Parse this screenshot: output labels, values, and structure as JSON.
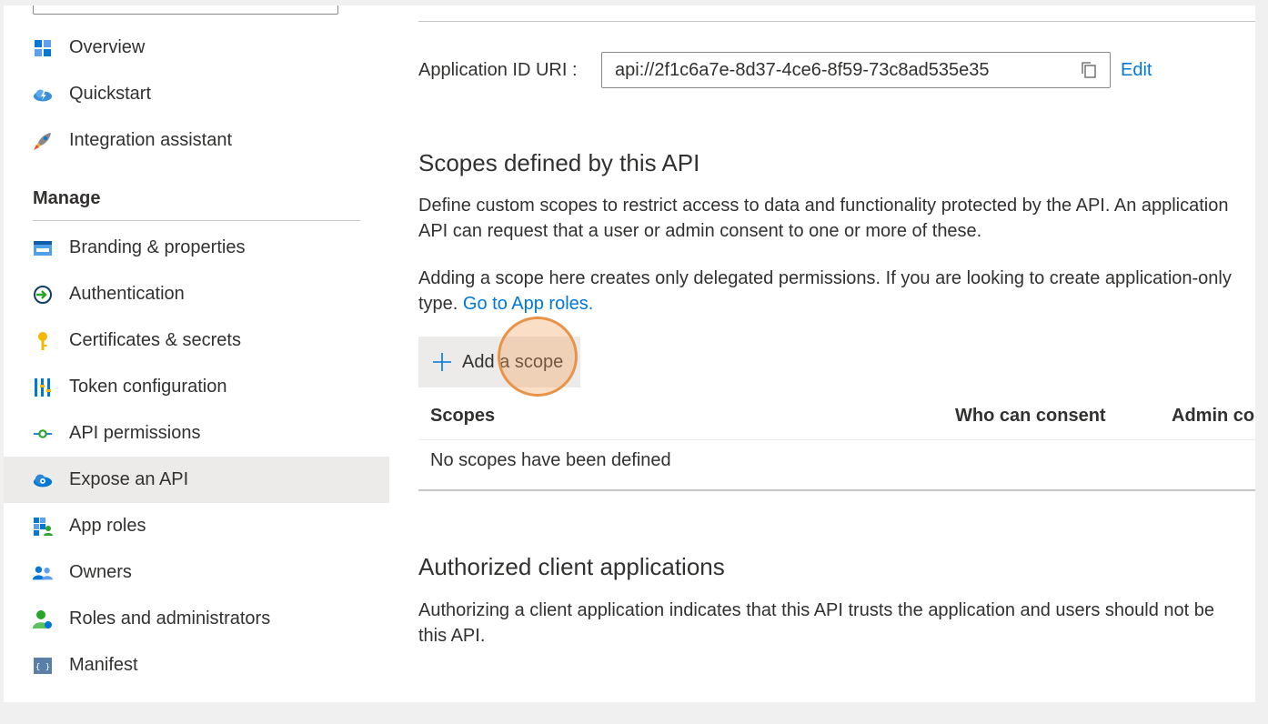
{
  "sidebar": {
    "items": [
      {
        "label": "Overview",
        "icon": "overview-icon"
      },
      {
        "label": "Quickstart",
        "icon": "quickstart-cloud-icon"
      },
      {
        "label": "Integration assistant",
        "icon": "rocket-icon"
      },
      {
        "label": "Branding & properties",
        "icon": "branding-icon"
      },
      {
        "label": "Authentication",
        "icon": "authentication-icon"
      },
      {
        "label": "Certificates & secrets",
        "icon": "key-icon"
      },
      {
        "label": "Token configuration",
        "icon": "token-bars-icon"
      },
      {
        "label": "API permissions",
        "icon": "api-permissions-icon"
      },
      {
        "label": "Expose an API",
        "icon": "cloud-gear-icon"
      },
      {
        "label": "App roles",
        "icon": "app-roles-icon"
      },
      {
        "label": "Owners",
        "icon": "owners-icon"
      },
      {
        "label": "Roles and administrators",
        "icon": "roles-admin-icon"
      },
      {
        "label": "Manifest",
        "icon": "manifest-icon"
      }
    ],
    "manage_heading": "Manage",
    "active_item": "Expose an API"
  },
  "main": {
    "uri_label": "Application ID URI :",
    "uri_value": "api://2f1c6a7e-8d37-4ce6-8f59-73c8ad535e35",
    "edit_label": "Edit",
    "scopes_heading": "Scopes defined by this API",
    "scopes_desc_line1": "Define custom scopes to restrict access to data and functionality protected by the API. An application",
    "scopes_desc_line2": "API can request that a user or admin consent to one or more of these.",
    "scope_note_line1": "Adding a scope here creates only delegated permissions. If you are looking to create application-only",
    "scope_note_prefix": "type.",
    "scope_note_link": "Go to App roles.",
    "add_scope_label": "Add a scope",
    "table": {
      "headers": [
        "Scopes",
        "Who can consent",
        "Admin co"
      ],
      "empty_message": "No scopes have been defined"
    },
    "clients_heading": "Authorized client applications",
    "clients_desc_line1": "Authorizing a client application indicates that this API trusts the application and users should not be",
    "clients_desc_line2": "this API."
  },
  "colors": {
    "accent": "#0078d4",
    "active_bg": "#edebe9",
    "click_marker": "#e8934a"
  }
}
